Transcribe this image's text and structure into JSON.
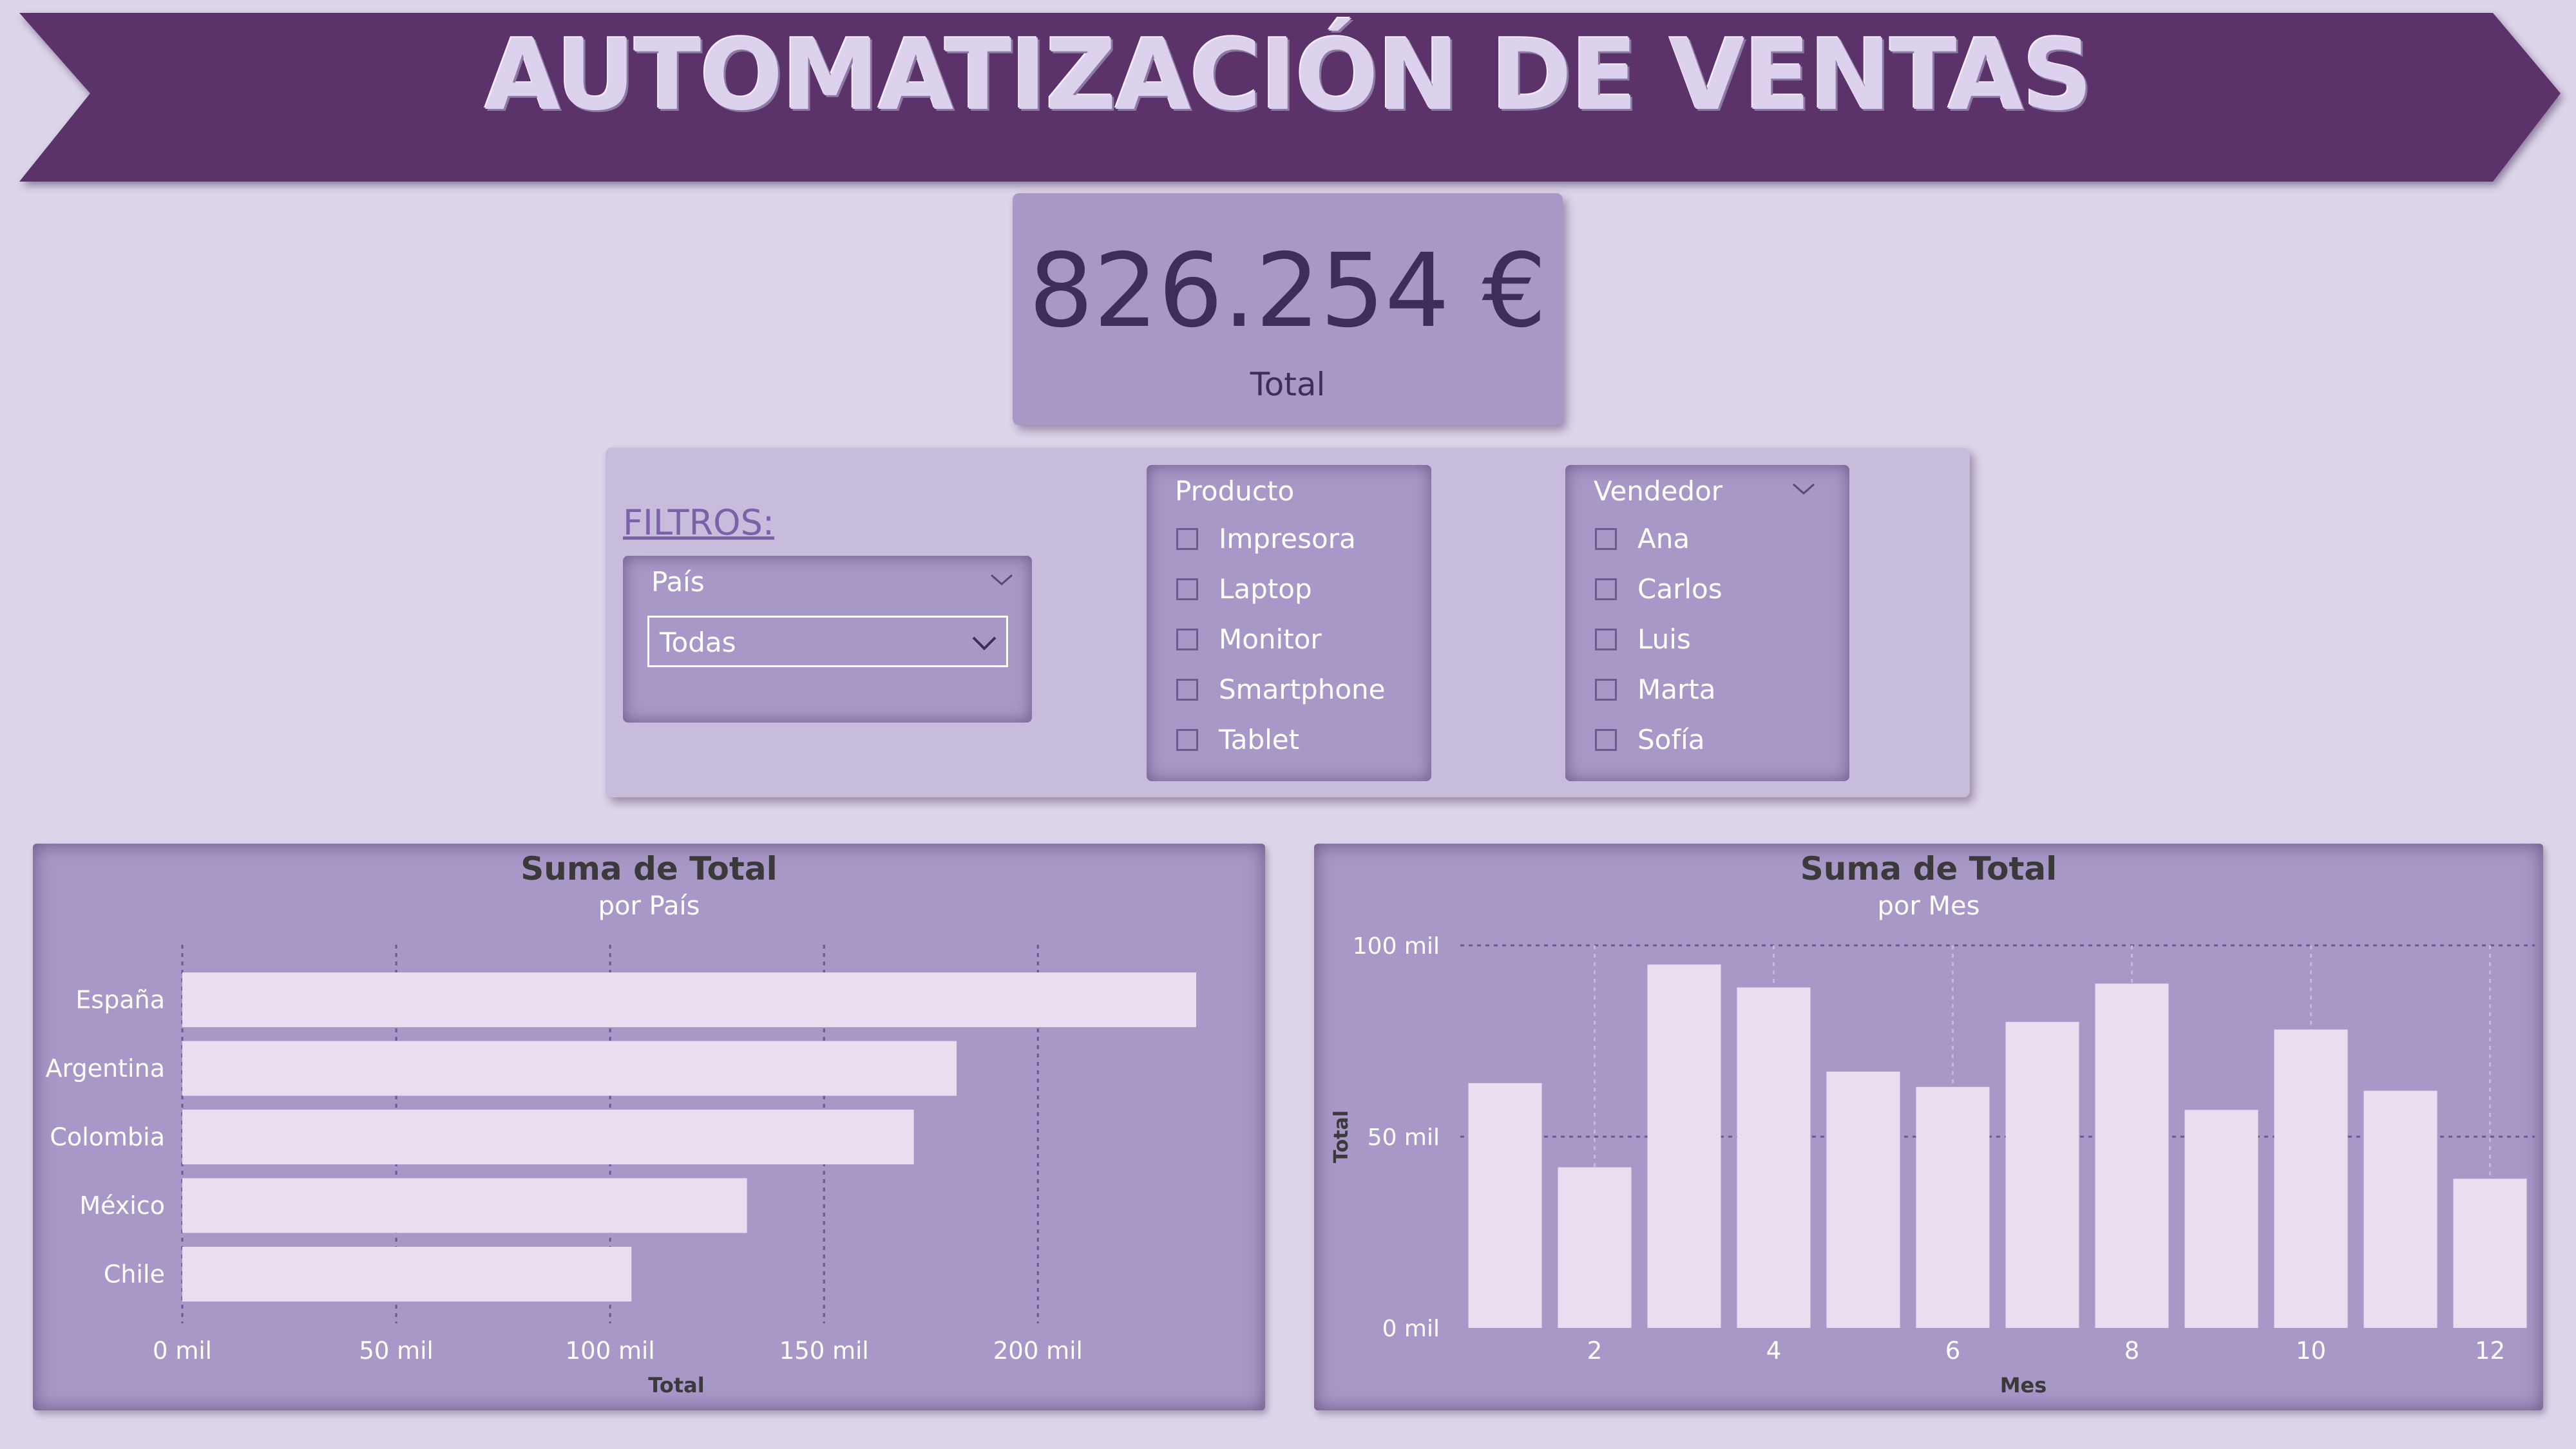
{
  "header": {
    "title": "AUTOMATIZACIÓN DE VENTAS"
  },
  "kpi": {
    "value": "826.254 €",
    "label": "Total"
  },
  "filters": {
    "heading": "FILTROS:",
    "pais": {
      "title": "País",
      "selected": "Todas"
    },
    "producto": {
      "title": "Producto",
      "options": [
        "Impresora",
        "Laptop",
        "Monitor",
        "Smartphone",
        "Tablet"
      ]
    },
    "vendedor": {
      "title": "Vendedor",
      "options": [
        "Ana",
        "Carlos",
        "Luis",
        "Marta",
        "Sofía"
      ]
    }
  },
  "colors": {
    "banner": "#5b336a",
    "panel": "#a898c8",
    "bar": "#e8def0",
    "background": "#ddd5ea"
  },
  "chart_data": [
    {
      "type": "bar",
      "orientation": "horizontal",
      "title": "Suma de Total",
      "subtitle": "por País",
      "xlabel": "Total",
      "ylabel": "",
      "categories": [
        "España",
        "Argentina",
        "Colombia",
        "México",
        "Chile"
      ],
      "values": [
        237000,
        181000,
        171000,
        132000,
        105000
      ],
      "xlim": [
        0,
        237000
      ],
      "ticks": [
        0,
        50000,
        100000,
        150000,
        200000
      ],
      "tick_labels": [
        "0 mil",
        "50 mil",
        "100 mil",
        "150 mil",
        "200 mil"
      ],
      "grid": true
    },
    {
      "type": "bar",
      "orientation": "vertical",
      "title": "Suma de Total",
      "subtitle": "por Mes",
      "xlabel": "Mes",
      "ylabel": "Total",
      "categories": [
        1,
        2,
        3,
        4,
        5,
        6,
        7,
        8,
        9,
        10,
        11,
        12
      ],
      "values": [
        64000,
        42000,
        95000,
        89000,
        67000,
        63000,
        80000,
        90000,
        57000,
        78000,
        62000,
        39000
      ],
      "x_tick_labels": [
        "2",
        "4",
        "6",
        "8",
        "10",
        "12"
      ],
      "ylim": [
        0,
        100000
      ],
      "ticks": [
        0,
        50000,
        100000
      ],
      "tick_labels": [
        "0 mil",
        "50 mil",
        "100 mil"
      ],
      "grid": true
    }
  ]
}
